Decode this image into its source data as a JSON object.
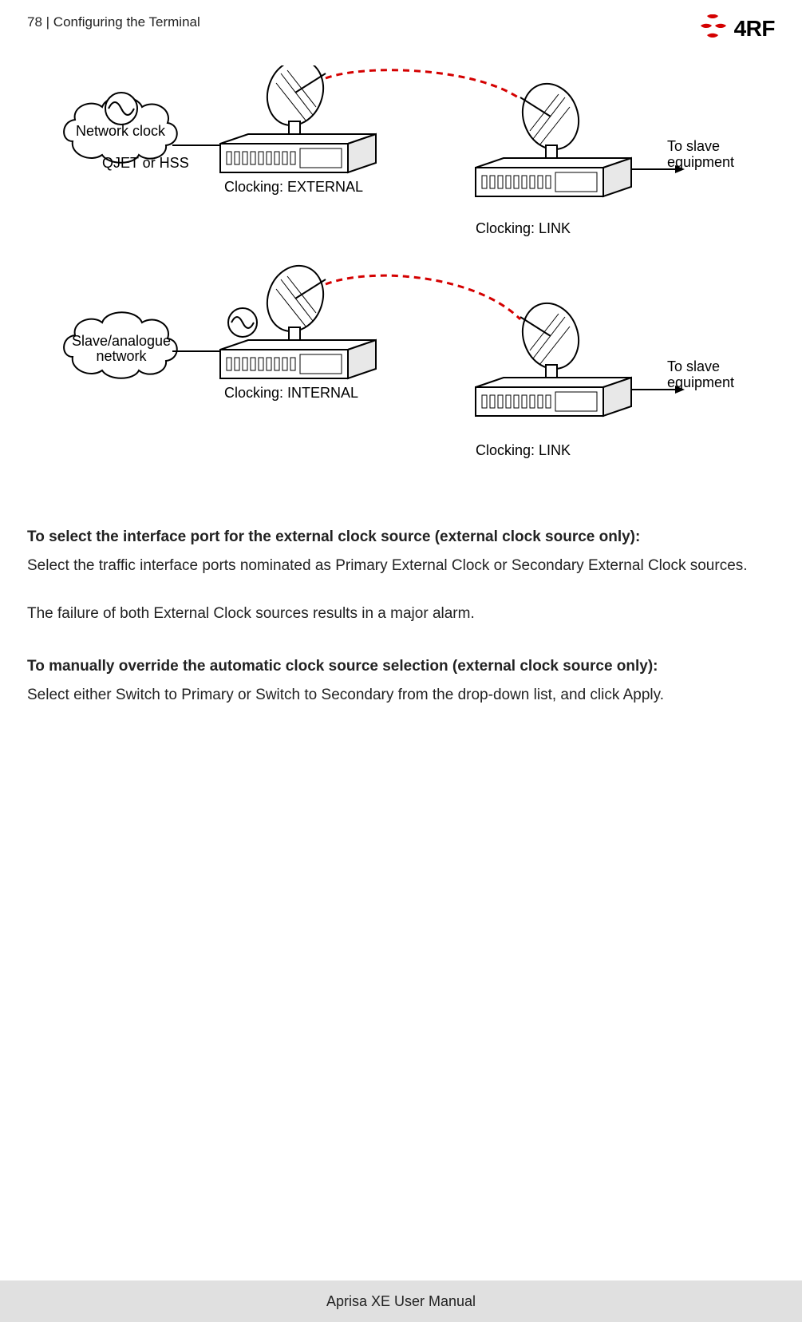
{
  "header": {
    "page_number": "78",
    "separator": "  |  ",
    "section": "Configuring the Terminal",
    "logo_text": "4RF"
  },
  "figure": {
    "cloud_network": "Network clock",
    "cloud_network_sub": "QJET or HSS",
    "cloud_slave_line1": "Slave/analogue",
    "cloud_slave_line2": "network",
    "clocking_external": "Clocking: EXTERNAL",
    "clocking_internal": "Clocking: INTERNAL",
    "clocking_link": "Clocking: LINK",
    "to_slave_line1": "To slave",
    "to_slave_line2": "equipment"
  },
  "content": {
    "h1": "To select the interface port for the external clock source (external clock source only):",
    "p1": "Select the traffic interface ports nominated as Primary External Clock or Secondary External Clock sources.",
    "p2": "The failure of both External Clock sources results in a major alarm.",
    "h2": "To manually override the automatic clock source selection (external clock source only):",
    "p3": "Select either Switch to Primary or Switch to Secondary from the drop-down list, and click Apply."
  },
  "footer": {
    "text": "Aprisa XE User Manual"
  }
}
